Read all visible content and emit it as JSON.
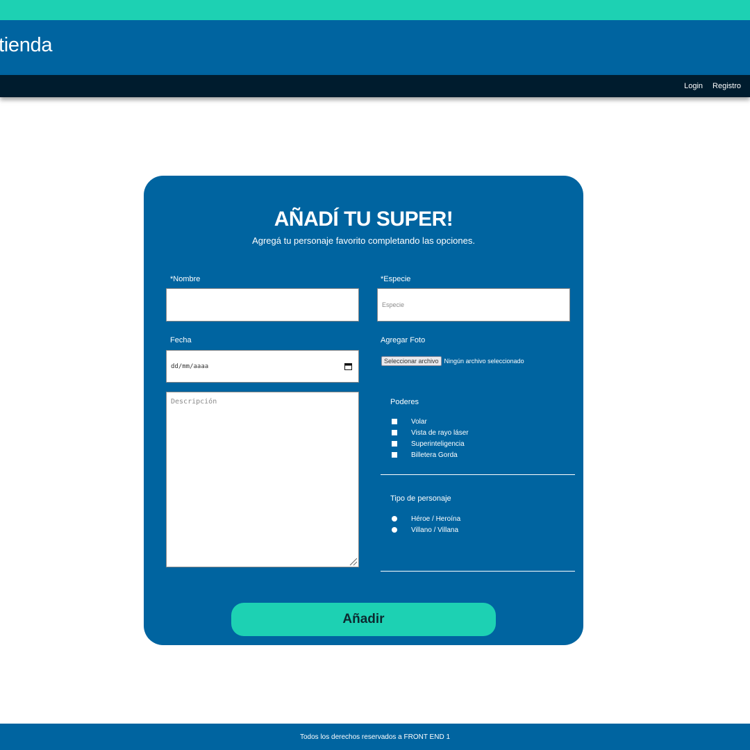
{
  "header": {
    "brand": "tienda",
    "nav": {
      "login": "Login",
      "register": "Registro"
    }
  },
  "form": {
    "title": "AÑADÍ TU SUPER!",
    "subtitle": "Agregá tu personaje favorito completando las opciones.",
    "name": {
      "label": "*Nombre",
      "value": ""
    },
    "species": {
      "label": "*Especie",
      "placeholder": "Especie"
    },
    "date": {
      "label": "Fecha",
      "placeholder": "dd/mm/aaaa"
    },
    "photo": {
      "label": "Agregar Foto",
      "button": "Seleccionar archivo",
      "status": "Ningún archivo seleccionado"
    },
    "description": {
      "placeholder": "Descripción"
    },
    "powers": {
      "label": "Poderes",
      "options": [
        "Volar",
        "Vista de rayo láser",
        "Superinteligencia",
        "Billetera Gorda"
      ]
    },
    "character_type": {
      "label": "Tipo de personaje",
      "options": [
        "Héroe / Heroína",
        "Villano / Villana"
      ]
    },
    "submit": "Añadir"
  },
  "footer": {
    "text": "Todos los derechos reservados a FRONT END 1"
  },
  "colors": {
    "accent": "#1dd1b3",
    "primary": "#0064a0",
    "nav": "#001c2e"
  },
  "icons": [
    "calendar-icon",
    "resize-handle-icon"
  ]
}
